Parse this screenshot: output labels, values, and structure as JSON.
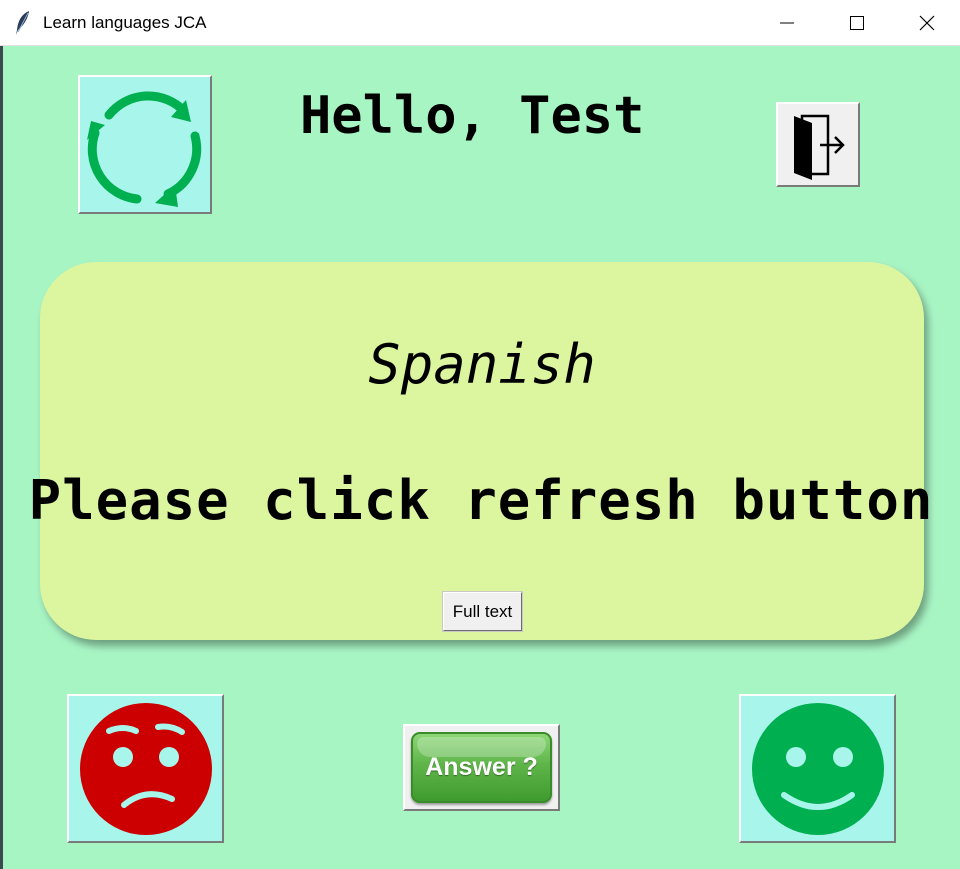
{
  "window": {
    "title": "Learn languages JCA",
    "controls": [
      "minimize",
      "maximize",
      "close"
    ]
  },
  "header": {
    "greeting": "Hello, Test",
    "refresh_icon": "refresh-arrows-icon",
    "logout_icon": "exit-door-icon"
  },
  "card": {
    "language": "Spanish",
    "phrase": "Please click refresh button",
    "full_text_label": "Full text"
  },
  "footer": {
    "wrong_icon": "sad-face-icon",
    "answer_label": "Answer ?",
    "correct_icon": "happy-face-icon"
  },
  "colors": {
    "background": "#a8f5c4",
    "card": "#dcf59f",
    "icon_button": "#a8f5ec",
    "refresh": "#00b050",
    "sad": "#cc0000",
    "happy": "#00b050",
    "answer": "#5fb54a"
  }
}
